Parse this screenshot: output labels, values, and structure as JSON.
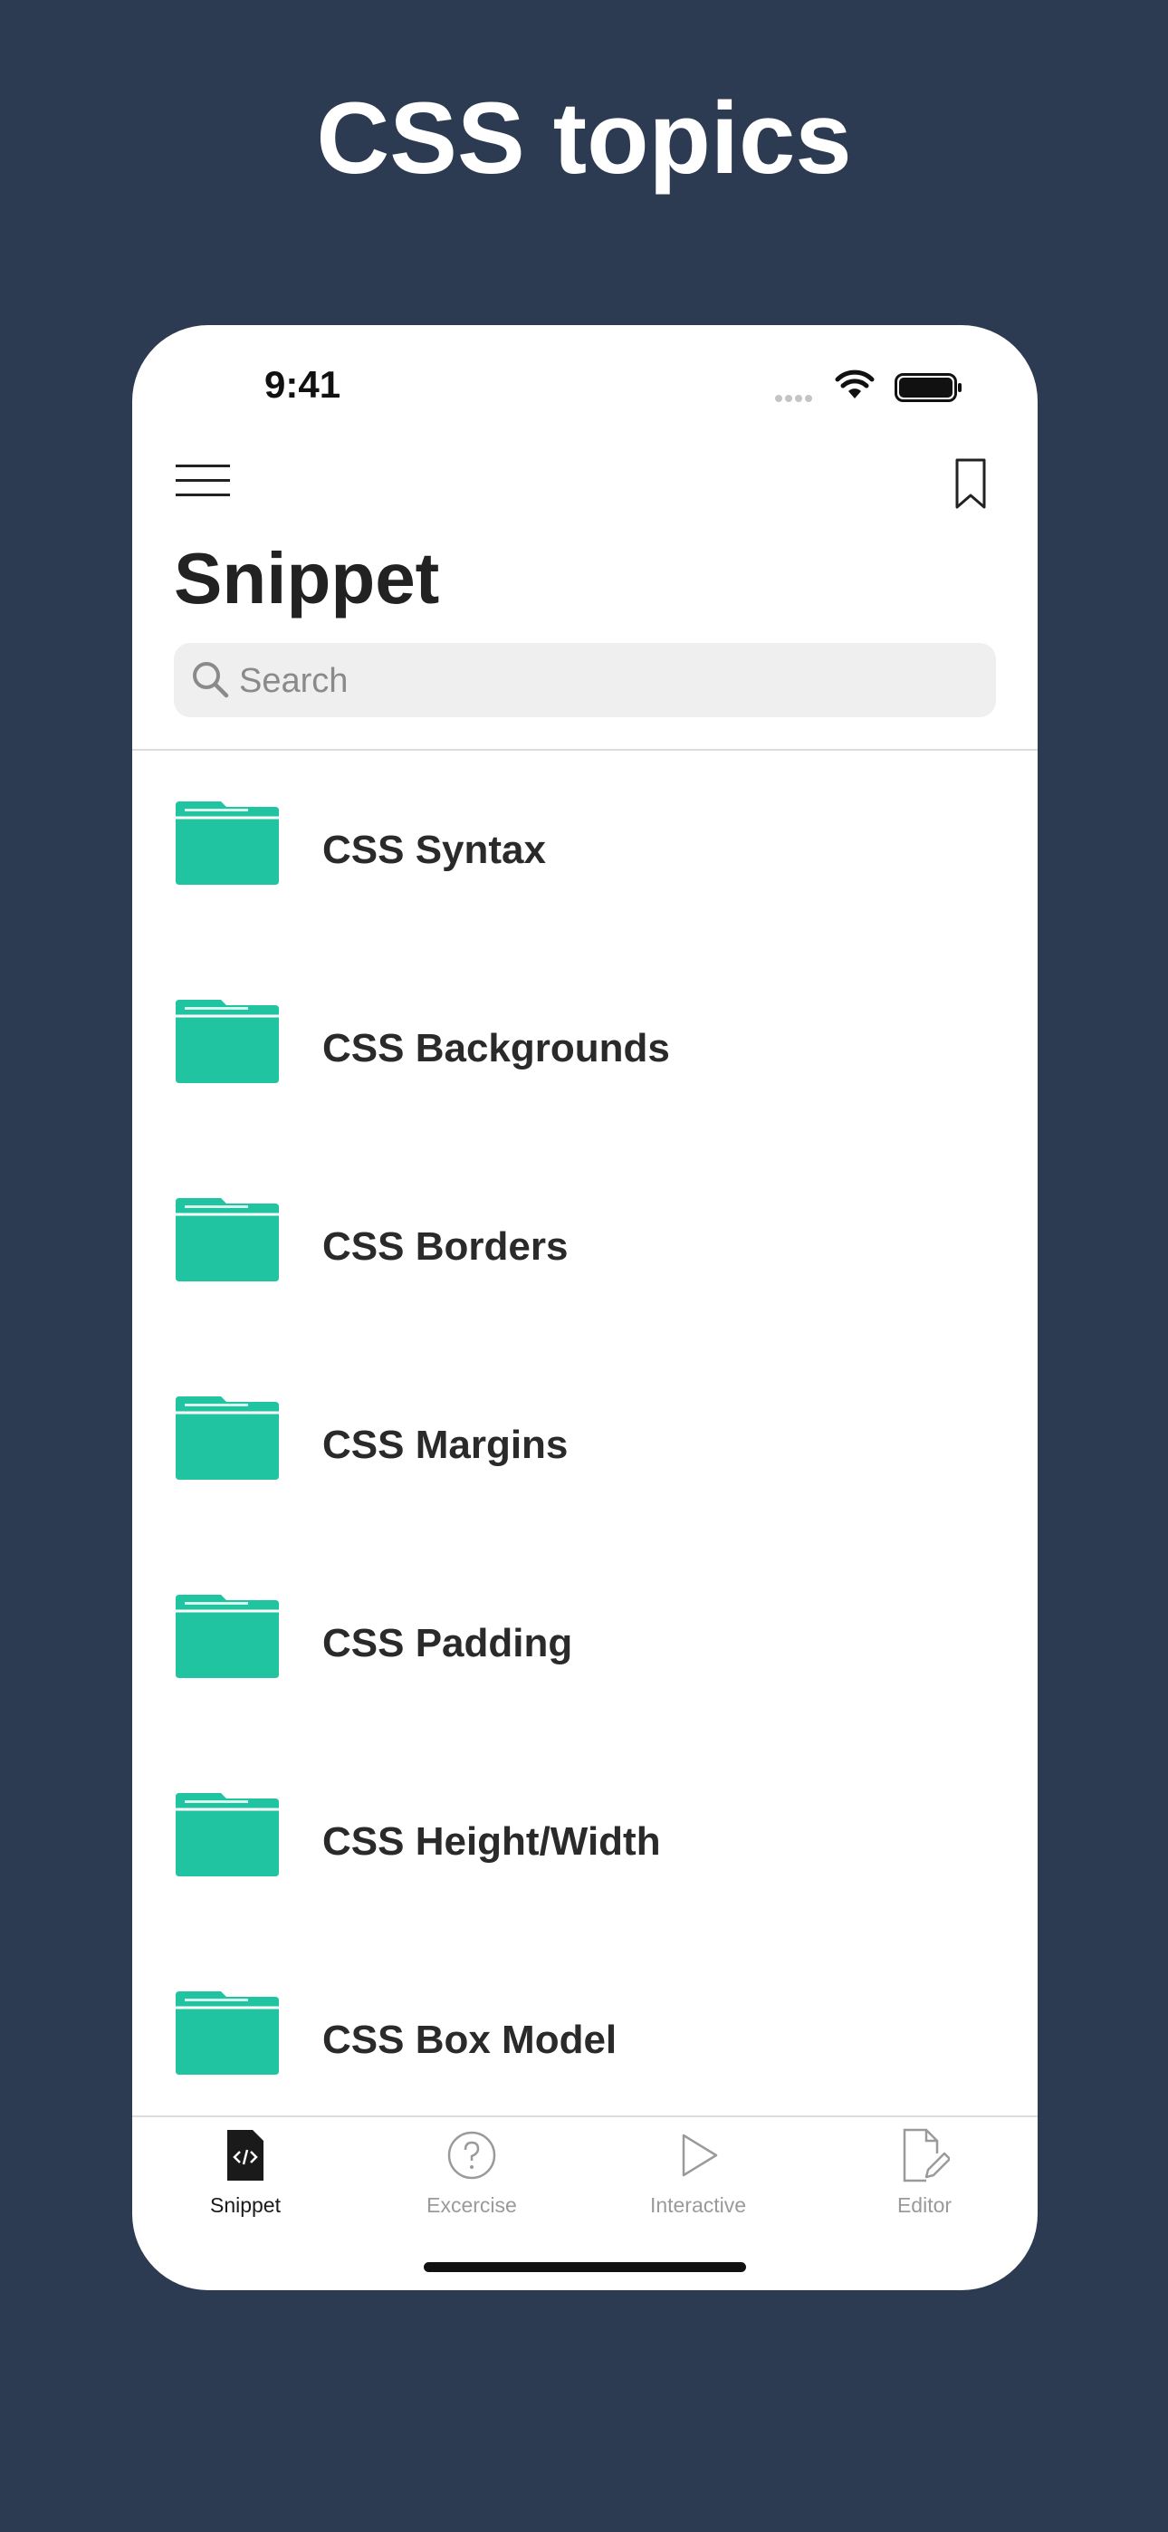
{
  "headline": "CSS topics",
  "status_bar": {
    "time": "9:41"
  },
  "header": {
    "title": "Snippet"
  },
  "search": {
    "placeholder": "Search",
    "value": ""
  },
  "topics": [
    {
      "label": "CSS Syntax"
    },
    {
      "label": "CSS Backgrounds"
    },
    {
      "label": "CSS Borders"
    },
    {
      "label": "CSS Margins"
    },
    {
      "label": "CSS Padding"
    },
    {
      "label": "CSS Height/Width"
    },
    {
      "label": "CSS Box Model"
    }
  ],
  "tabs": [
    {
      "label": "Snippet",
      "icon": "code-document-icon",
      "active": true
    },
    {
      "label": "Excercise",
      "icon": "question-circle-icon",
      "active": false
    },
    {
      "label": "Interactive",
      "icon": "play-icon",
      "active": false
    },
    {
      "label": "Editor",
      "icon": "document-edit-icon",
      "active": false
    }
  ],
  "colors": {
    "background": "#2c3a52",
    "accent_folder": "#20c4a0",
    "active_tab": "#1a1a1a",
    "inactive_tab": "#9a9a9a"
  }
}
